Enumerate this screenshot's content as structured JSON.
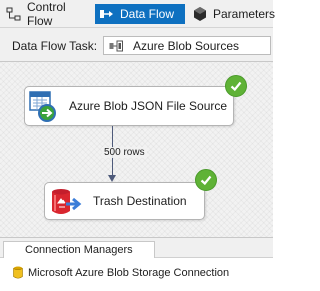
{
  "tabs": {
    "control_flow": "Control Flow",
    "data_flow": "Data Flow",
    "parameters": "Parameters"
  },
  "task": {
    "label": "Data Flow Task:",
    "selected": "Azure Blob Sources"
  },
  "components": {
    "source": {
      "label": "Azure Blob JSON File Source",
      "status": "success",
      "icon": "azure-blob-json-source-icon"
    },
    "destination": {
      "label": "Trash Destination",
      "status": "success",
      "icon": "trash-destination-icon"
    }
  },
  "path": {
    "label": "500 rows"
  },
  "connection_managers": {
    "tab_label": "Connection Managers",
    "items": [
      {
        "label": "Microsoft Azure Blob Storage Connection",
        "icon": "storage-connection-icon"
      }
    ]
  },
  "colors": {
    "active_tab": "#0e70c0",
    "success": "#5fb236",
    "path": "#4e5a7a"
  }
}
